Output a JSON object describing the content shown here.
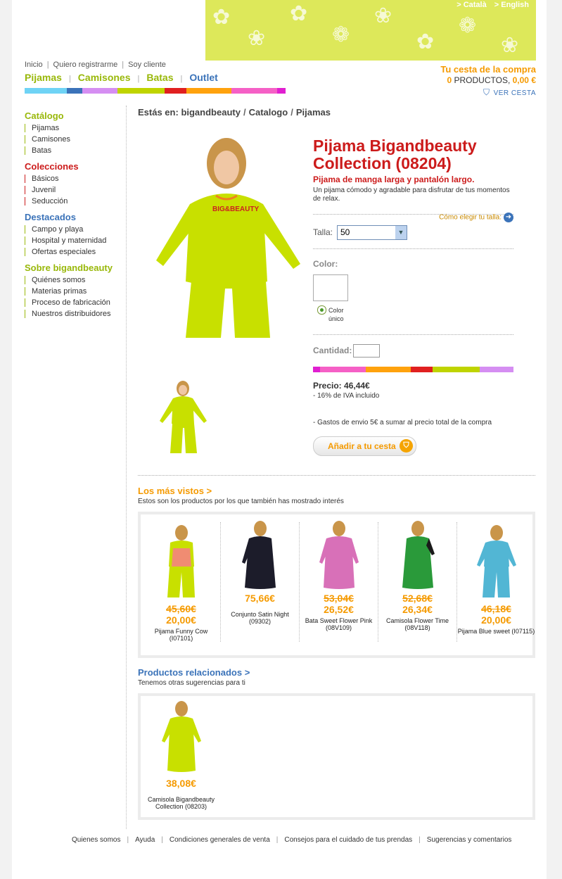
{
  "header": {
    "lang": [
      "> Català",
      "> English"
    ],
    "top_links": [
      "Inicio",
      "Quiero registrarme",
      "Soy cliente"
    ],
    "nav": [
      "Pijamas",
      "Camisones",
      "Batas",
      "Outlet"
    ],
    "stripe_colors": [
      "#6fd3f5",
      "#3b73b9",
      "#d58ef2",
      "#bfd400",
      "#e02020",
      "#ffa20d",
      "#f560c6",
      "#e01fd0"
    ]
  },
  "cart": {
    "title": "Tu cesta de la compra",
    "count": "0",
    "products_label": " PRODUCTOS, ",
    "amount": "0,00 €",
    "view": "VER CESTA"
  },
  "sidebar": {
    "sections": [
      {
        "title": "Catálogo",
        "color": "#99b80a",
        "items": [
          "Pijamas",
          "Camisones",
          "Batas"
        ]
      },
      {
        "title": "Colecciones",
        "color": "#cc1b1b",
        "items": [
          "Básicos",
          "Juvenil",
          "Seducción"
        ]
      },
      {
        "title": "Destacados",
        "color": "#3b73b9",
        "items": [
          "Campo y playa",
          "Hospital y maternidad",
          "Ofertas especiales"
        ]
      },
      {
        "title": "Sobre bigandbeauty",
        "color": "#99b80a",
        "items": [
          "Quiénes somos",
          "Materias primas",
          "Proceso de fabricación",
          "Nuestros distribuidores"
        ]
      }
    ]
  },
  "breadcrumb": {
    "prefix": "Estás en:",
    "items": [
      "bigandbeauty",
      "Catalogo",
      "Pijamas"
    ]
  },
  "product": {
    "title": "Pijama Bigandbeauty Collection (08204)",
    "subtitle": "Pijama de manga larga y pantalón largo.",
    "description": "Un pijama cómodo y agradable para disfrutar de tus momentos de relax.",
    "size_guide": "Cómo elegir tu talla:",
    "size_label": "Talla:",
    "size_value": "50",
    "color_label": "Color:",
    "color_option": "Color único",
    "quantity_label": "Cantidad:",
    "price": "Precio: 46,44€",
    "iva": "- 16% de IVA incluido",
    "shipping": "- Gastos de envio 5€ a sumar al precio total de la compra",
    "add_to_cart": "Añadir a tu cesta",
    "stripe_colors": [
      "#e01fd0",
      "#f560c6",
      "#ffa20d",
      "#e02020",
      "#bfd400",
      "#bfd400",
      "#d58ef2"
    ]
  },
  "most_viewed": {
    "title": "Los más vistos >",
    "subtitle": "Estos son los productos por los que también has mostrado interés",
    "items": [
      {
        "old_price": "45,60€",
        "price": "20,00€",
        "name": "Pijama Funny Cow (I07101)",
        "color": "#c8e000"
      },
      {
        "old_price": "",
        "price": "75,66€",
        "name": "Conjunto Satin Night (09302)",
        "color": "#1c1c2a"
      },
      {
        "old_price": "53,04€",
        "price": "26,52€",
        "name": "Bata Sweet Flower Pink (08V109)",
        "color": "#d870b8"
      },
      {
        "old_price": "52,68€",
        "price": "26,34€",
        "name": "Camisola Flower Time (08V118)",
        "color": "#2a9a3a"
      },
      {
        "old_price": "46,18€",
        "price": "20,00€",
        "name": "Pijama Blue sweet (I07115)",
        "color": "#52b6d4"
      }
    ]
  },
  "related": {
    "title": "Productos relacionados >",
    "subtitle": "Tenemos otras sugerencias para ti",
    "items": [
      {
        "price": "38,08€",
        "name": "Camisola Bigandbeauty Collection (08203)",
        "color": "#c8e000"
      }
    ]
  },
  "footer": [
    "Quienes somos",
    "Ayuda",
    "Condiciones generales de venta",
    "Consejos para el cuidado de tus prendas",
    "Sugerencias y comentarios"
  ]
}
